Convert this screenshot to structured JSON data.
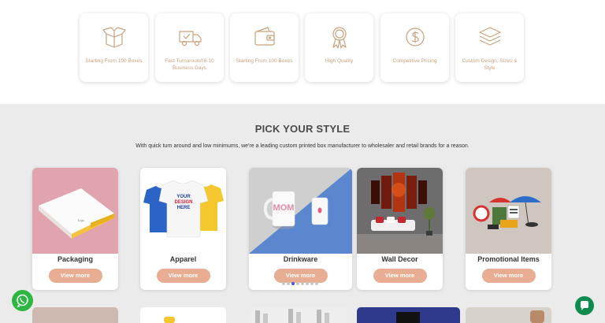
{
  "features": [
    {
      "icon": "open-box-icon",
      "label": "Starting From 100 Boxes"
    },
    {
      "icon": "delivery-truck-icon",
      "label": "Fast Turnaround 8-10 Business Days"
    },
    {
      "icon": "wallet-icon",
      "label": "Starting From 100 Boxes"
    },
    {
      "icon": "quality-badge-icon",
      "label": "High Quality"
    },
    {
      "icon": "dollar-coin-icon",
      "label": "Competitive Pricing"
    },
    {
      "icon": "layers-icon",
      "label": "Custom Design, Sizes & Style"
    }
  ],
  "section": {
    "title": "PICK YOUR STYLE",
    "subtitle": "With quick turn around and low minimums, we're a leading custom printed box manufacturer to wholesaler and retail brands for a reason."
  },
  "cards": [
    {
      "title": "Packaging",
      "button": "View more"
    },
    {
      "title": "Apparel",
      "button": "View more"
    },
    {
      "title": "Drinkware",
      "button": "View more"
    },
    {
      "title": "Wall Decor",
      "button": "View more"
    },
    {
      "title": "Promotional Items",
      "button": "View more"
    }
  ],
  "imagery": {
    "tshirt_print": "YOUR DESIGN HERE",
    "mug_print": "MOM"
  },
  "carousel": {
    "total_dots": 8,
    "active_index": 2
  },
  "colors": {
    "accent": "#e8ad93",
    "icon_gold": "#c9a27e",
    "whatsapp": "#2db742",
    "chat": "#0f8b4f"
  }
}
